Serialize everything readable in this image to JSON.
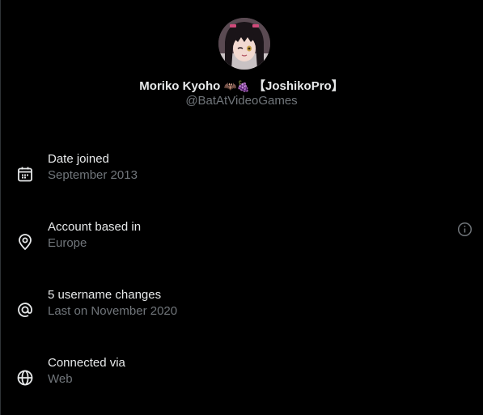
{
  "profile": {
    "display_name": "Moriko Kyoho",
    "display_name_emoji": "🦇🍇",
    "display_name_tag": "【JoshikoPro】",
    "handle": "@BatAtVideoGames"
  },
  "details": [
    {
      "icon": "calendar-icon",
      "label": "Date joined",
      "value": "September 2013"
    },
    {
      "icon": "location-pin-icon",
      "label": "Account based in",
      "value": "Europe"
    },
    {
      "icon": "at-sign-icon",
      "label": "5 username changes",
      "value": "Last on November 2020"
    },
    {
      "icon": "globe-icon",
      "label": "Connected via",
      "value": "Web"
    }
  ],
  "colors": {
    "background": "#000000",
    "primary_text": "#e7e9ea",
    "secondary_text": "#71767b"
  }
}
